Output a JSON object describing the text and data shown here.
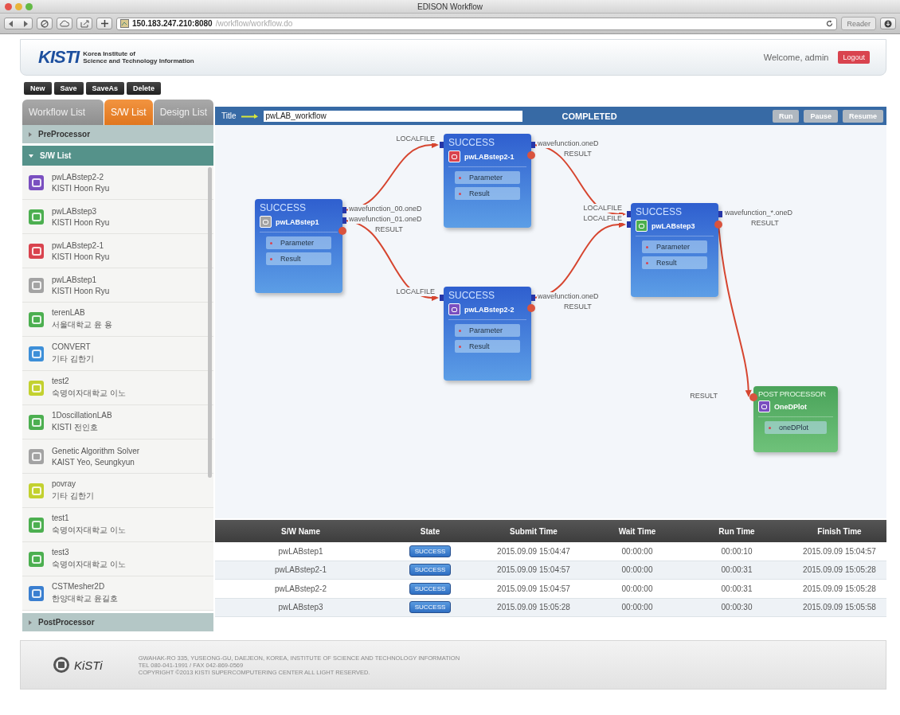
{
  "browser": {
    "title": "EDISON Workflow",
    "url_host": "150.183.247.210:8080",
    "url_path": "/workflow/workflow.do",
    "reader": "Reader"
  },
  "header": {
    "logo": "KISTI",
    "org_lines": [
      "Korea Institute of",
      "Science and Technology Information"
    ],
    "welcome": "Welcome, admin",
    "logout": "Logout"
  },
  "toolbar": [
    "New",
    "Save",
    "SaveAs",
    "Delete"
  ],
  "sidebar": {
    "tabs": [
      {
        "label": "Workflow  List",
        "selected": false
      },
      {
        "label": "S/W List",
        "selected": true
      },
      {
        "label": "Design List",
        "selected": false
      }
    ],
    "sections": [
      {
        "label": "PreProcessor",
        "expanded": false
      },
      {
        "label": "S/W List",
        "expanded": true,
        "items": [
          {
            "name": "pwLABstep2-2",
            "owner": "KISTI  Hoon Ryu",
            "color": "#7a4fc0"
          },
          {
            "name": "pwLABstep3",
            "owner": "KISTI  Hoon Ryu",
            "color": "#4caf50"
          },
          {
            "name": "pwLABstep2-1",
            "owner": "KISTI  Hoon Ryu",
            "color": "#d9434e"
          },
          {
            "name": "pwLABstep1",
            "owner": "KISTI  Hoon Ryu",
            "color": "#a3a3a3"
          },
          {
            "name": "terenLAB",
            "owner": "서울대학교  윤 용",
            "color": "#4caf50"
          },
          {
            "name": "CONVERT",
            "owner": "기타  김한기",
            "color": "#3d8fd8"
          },
          {
            "name": "test2",
            "owner": "숙명여자대학교  이노",
            "color": "#c3d12f"
          },
          {
            "name": "1DoscillationLAB",
            "owner": "KISTI  전인호",
            "color": "#4caf50"
          },
          {
            "name": "Genetic Algorithm Solver",
            "owner": "KAIST  Yeo, Seungkyun",
            "color": "#a3a3a3"
          },
          {
            "name": "povray",
            "owner": "기타  김한기",
            "color": "#c3d12f"
          },
          {
            "name": "test1",
            "owner": "숙명여자대학교  이노",
            "color": "#4caf50"
          },
          {
            "name": "test3",
            "owner": "숙명여자대학교  이노",
            "color": "#4caf50"
          },
          {
            "name": "CSTMesher2D",
            "owner": "한양대학교  윤길호",
            "color": "#3a7fd0"
          }
        ]
      },
      {
        "label": "PostProcessor",
        "expanded": false
      }
    ]
  },
  "workflow": {
    "title_label": "Title",
    "title_value": "pwLAB_workflow",
    "status": "COMPLETED",
    "buttons": [
      {
        "label": "Run",
        "disabled": true
      },
      {
        "label": "Pause",
        "disabled": true
      },
      {
        "label": "Resume",
        "disabled": true
      }
    ],
    "nodes": [
      {
        "kind": "solver",
        "status": "SUCCESS",
        "name": "pwLABstep1",
        "color": "#a3a3a3",
        "params": [
          "Parameter",
          "Result"
        ],
        "outputs": [
          {
            "label": "wavefunction_00.oneD",
            "kind": "file"
          },
          {
            "label": "wavefunction_01.oneD",
            "kind": "file"
          },
          {
            "label": "RESULT",
            "kind": "result"
          }
        ]
      },
      {
        "kind": "solver",
        "status": "SUCCESS",
        "name": "pwLABstep2-1",
        "color": "#d9434e",
        "params": [
          "Parameter",
          "Result"
        ],
        "inputs": [
          "LOCALFILE"
        ],
        "outputs": [
          {
            "label": "wavefunction.oneD",
            "kind": "file"
          },
          {
            "label": "RESULT",
            "kind": "result"
          }
        ]
      },
      {
        "kind": "solver",
        "status": "SUCCESS",
        "name": "pwLABstep2-2",
        "color": "#7a4fc0",
        "params": [
          "Parameter",
          "Result"
        ],
        "inputs": [
          "LOCALFILE"
        ],
        "outputs": [
          {
            "label": "wavefunction.oneD",
            "kind": "file"
          },
          {
            "label": "RESULT",
            "kind": "result"
          }
        ]
      },
      {
        "kind": "solver",
        "status": "SUCCESS",
        "name": "pwLABstep3",
        "color": "#4caf50",
        "params": [
          "Parameter",
          "Result"
        ],
        "inputs": [
          "LOCALFILE",
          "LOCALFILE"
        ],
        "outputs": [
          {
            "label": "wavefunction_*.oneD",
            "kind": "file"
          },
          {
            "label": "RESULT",
            "kind": "result"
          }
        ]
      },
      {
        "kind": "post",
        "status": "POST PROCESSOR",
        "name": "OneDPlot",
        "color": "#7a4fc0",
        "params": [
          "oneDPlot"
        ],
        "inputs": [
          "RESULT"
        ]
      }
    ]
  },
  "table": {
    "columns": [
      "S/W Name",
      "State",
      "Submit Time",
      "Wait Time",
      "Run Time",
      "Finish Time"
    ],
    "rows": [
      [
        "pwLABstep1",
        "SUCCESS",
        "2015.09.09 15:04:47",
        "00:00:00",
        "00:00:10",
        "2015.09.09 15:04:57"
      ],
      [
        "pwLABstep2-1",
        "SUCCESS",
        "2015.09.09 15:04:57",
        "00:00:00",
        "00:00:31",
        "2015.09.09 15:05:28"
      ],
      [
        "pwLABstep2-2",
        "SUCCESS",
        "2015.09.09 15:04:57",
        "00:00:00",
        "00:00:31",
        "2015.09.09 15:05:28"
      ],
      [
        "pwLABstep3",
        "SUCCESS",
        "2015.09.09 15:05:28",
        "00:00:00",
        "00:00:30",
        "2015.09.09 15:05:58"
      ]
    ]
  },
  "footer": {
    "logo": "KiSTi",
    "lines": [
      "GWAHAK-RO 335, YUSEONG-GU, DAEJEON, KOREA, INSTITUTE OF SCIENCE AND TECHNOLOGY INFORMATION",
      "TEL 080-041-1991 / FAX 042-869-0569",
      "COPYRIGHT ©2013 KISTI SUPERCOMPUTERING CENTER ALL LIGHT RESERVED."
    ]
  }
}
